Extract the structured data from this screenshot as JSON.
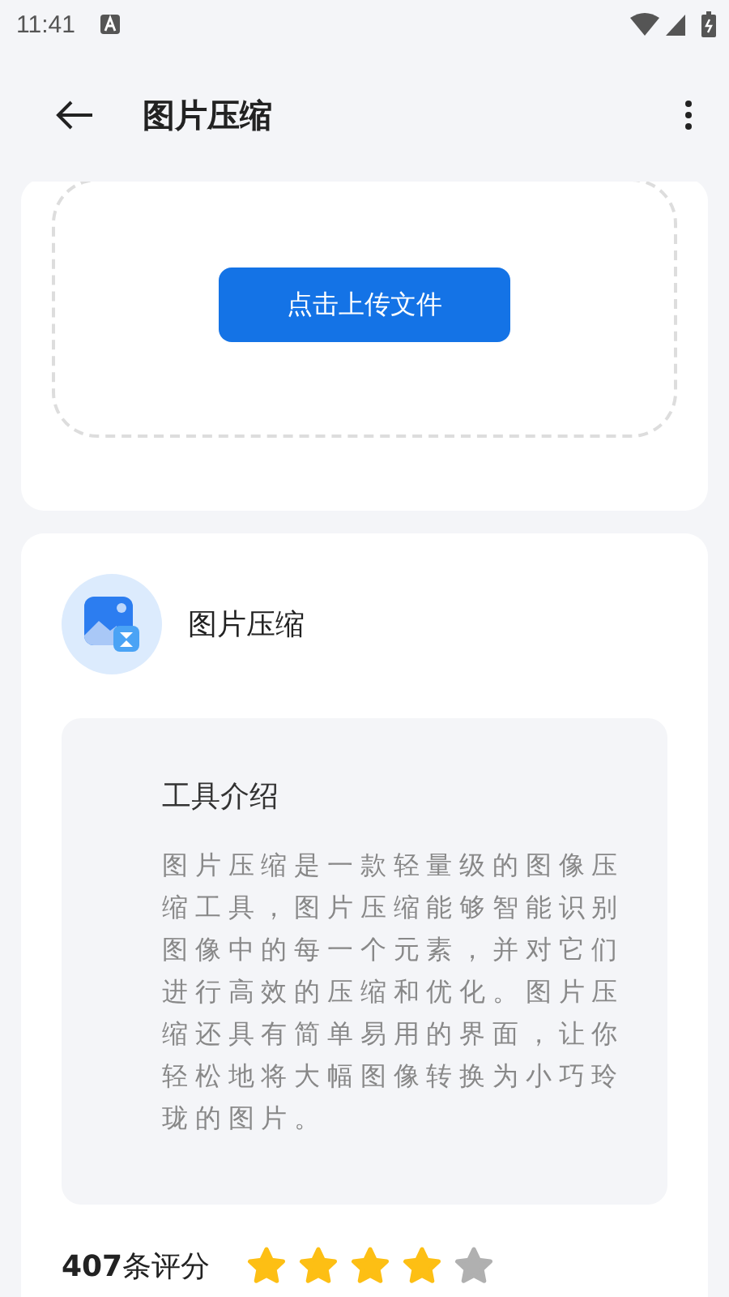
{
  "status_bar": {
    "time": "11:41"
  },
  "app_bar": {
    "title": "图片压缩"
  },
  "upload": {
    "button": "点击上传文件"
  },
  "tool": {
    "name": "图片压缩",
    "intro_title": "工具介绍",
    "intro_text": "图片压缩是一款轻量级的图像压缩工具，图片压缩能够智能识别图像中的每一个元素，并对它们进行高效的压缩和优化。图片压缩还具有简单易用的界面，让你轻松地将大幅图像转换为小巧玲珑的图片。"
  },
  "rating": {
    "count": "407",
    "label": "条评分",
    "stars": 4
  }
}
